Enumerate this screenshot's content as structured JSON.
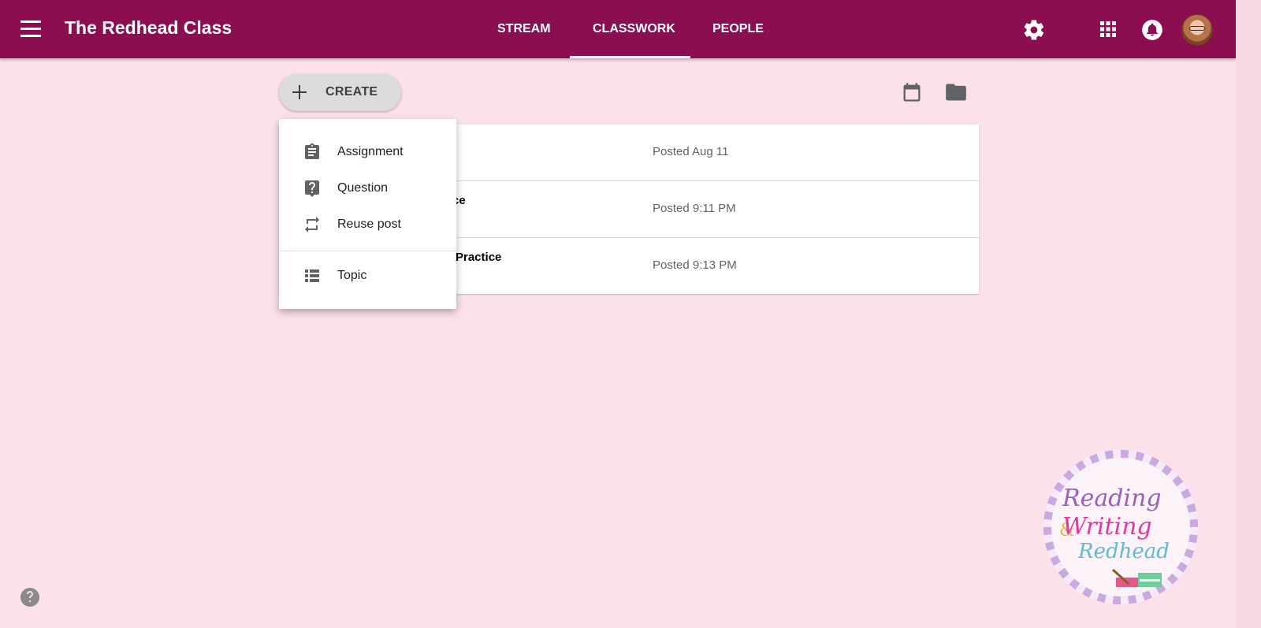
{
  "header": {
    "class_title": "The Redhead Class",
    "tabs": [
      {
        "label": "STREAM",
        "active": false
      },
      {
        "label": "CLASSWORK",
        "active": true
      },
      {
        "label": "PEOPLE",
        "active": false
      }
    ],
    "icons": [
      "menu-icon",
      "gear-icon",
      "apps-icon",
      "notifications-icon",
      "avatar"
    ]
  },
  "toolbar": {
    "create_label": "CREATE",
    "icons": [
      "calendar-icon",
      "folder-icon"
    ]
  },
  "create_menu": {
    "items": [
      {
        "label": "Assignment",
        "icon": "assignment-icon"
      },
      {
        "label": "Question",
        "icon": "question-icon"
      },
      {
        "label": "Reuse post",
        "icon": "reuse-icon"
      },
      {
        "label": "Topic",
        "icon": "topic-icon"
      }
    ]
  },
  "posts": [
    {
      "title": "",
      "date": "Posted Aug 11"
    },
    {
      "title": "ce",
      "date": "Posted 9:11 PM"
    },
    {
      "title": "Practice",
      "date": "Posted 9:13 PM"
    }
  ],
  "logo": {
    "line1": "Reading",
    "amp": "&",
    "line2": "Writing",
    "line3": "Redhead"
  },
  "colors": {
    "header": "#8b0e51",
    "background": "#fce1eb",
    "create_button": "#dcdcdc"
  }
}
